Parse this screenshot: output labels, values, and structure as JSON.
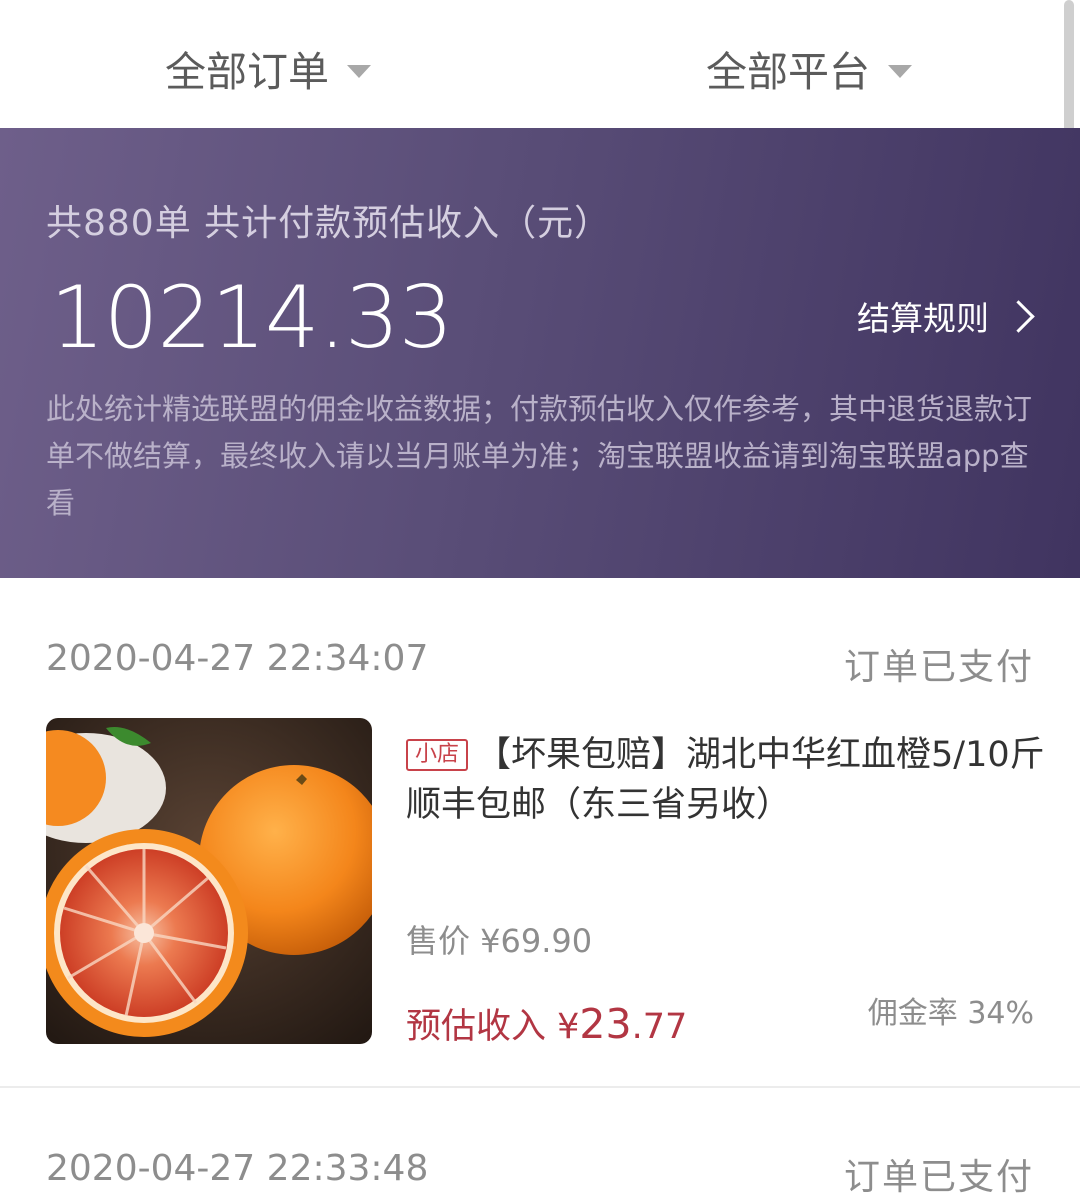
{
  "filters": {
    "orders_label": "全部订单",
    "platform_label": "全部平台"
  },
  "summary": {
    "count_line": "共880单 共计付款预估收入（元）",
    "amount": "10214.33",
    "rules_label": "结算规则",
    "note": "此处统计精选联盟的佣金收益数据；付款预估收入仅作参考，其中退货退款订单不做结算，最终收入请以当月账单为准；淘宝联盟收益请到淘宝联盟app查看"
  },
  "orders": [
    {
      "time": "2020-04-27 22:34:07",
      "status": "订单已支付",
      "shop_tag": "小店",
      "title": "【坏果包赔】湖北中华红血橙5/10斤 顺丰包邮（东三省另收）",
      "price": "售价 ¥69.90",
      "income_label": "预估收入 ¥",
      "income_int": "23",
      "income_dec": ".77",
      "rate": "佣金率 34%"
    },
    {
      "time": "2020-04-27 22:33:48",
      "status": "订单已支付"
    }
  ],
  "colors": {
    "banner_start": "#6e5f8a",
    "banner_end": "#403460",
    "income_red": "#b23643"
  }
}
